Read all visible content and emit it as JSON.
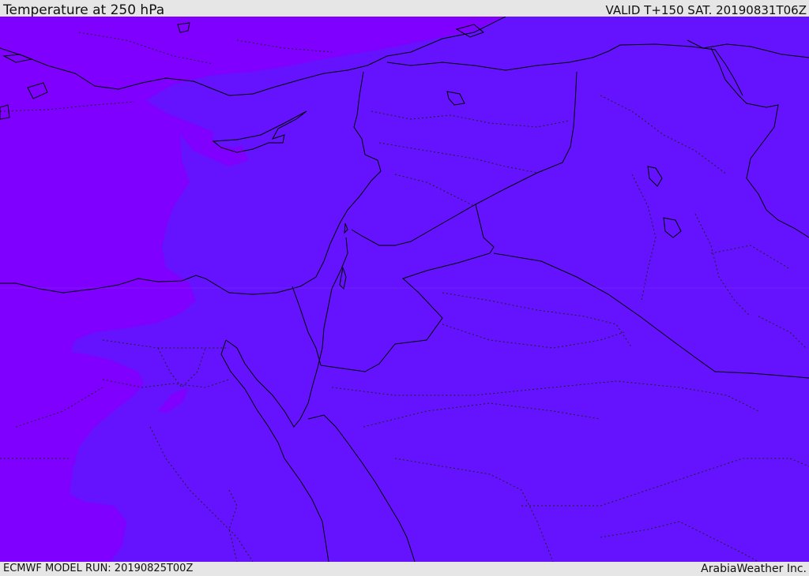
{
  "header": {
    "title": "Temperature at 250 hPa",
    "valid": "VALID T+150 SAT. 20190831T06Z"
  },
  "footer": {
    "model_run": "ECMWF MODEL RUN: 20190825T00Z",
    "credit": "ArabiaWeather Inc."
  },
  "colors": {
    "cold_zone": "#7f00ff",
    "warm_zone": "#6512ff",
    "boundary": "#000000"
  },
  "map": {
    "region": "Eastern Mediterranean and Middle East",
    "variable": "temperature",
    "level_hpa": 250
  }
}
